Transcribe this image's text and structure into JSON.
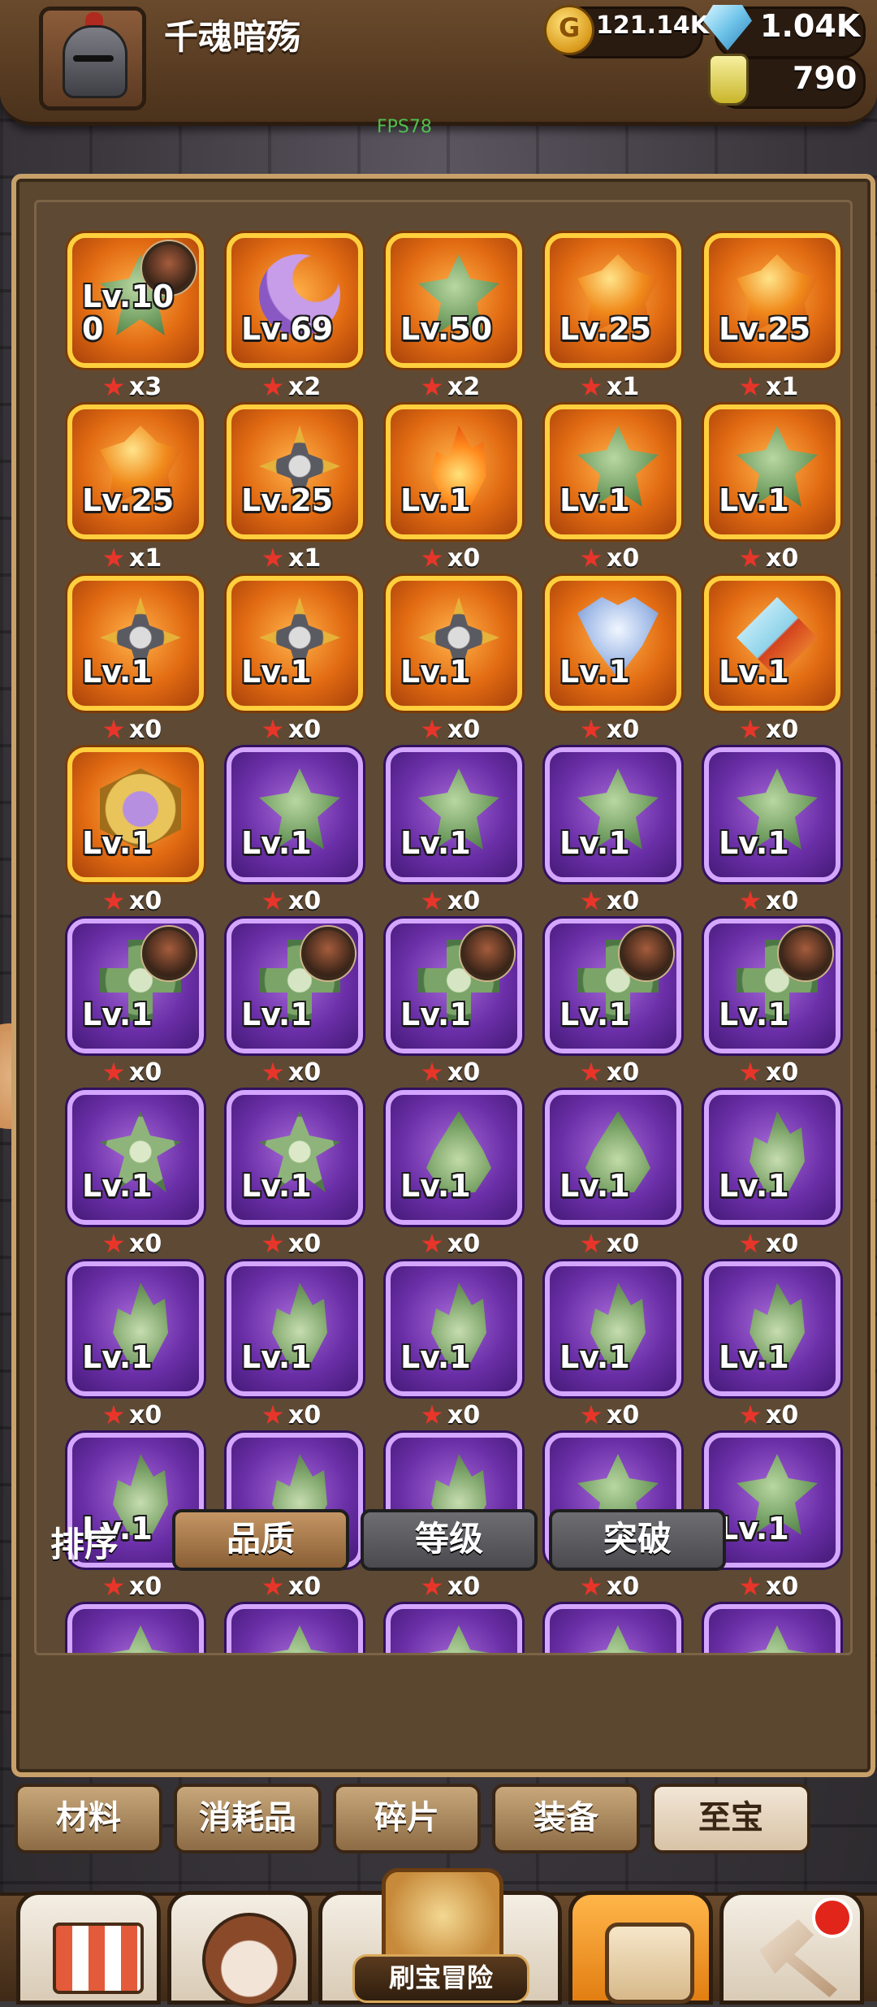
{
  "header": {
    "player_name": "千魂暗殇",
    "gold": "121.14K",
    "gems": "1.04K",
    "potions": "790",
    "fps": "FPS78"
  },
  "items": [
    {
      "lv": "Lv.10\n0",
      "count": "x3",
      "quality": "orange",
      "icon": "leaf-ornament-icon",
      "badge": true
    },
    {
      "lv": "Lv.69",
      "count": "x2",
      "quality": "orange",
      "icon": "crescent-moon-icon",
      "badge": false
    },
    {
      "lv": "Lv.50",
      "count": "x2",
      "quality": "orange",
      "icon": "green-crest-icon",
      "badge": false
    },
    {
      "lv": "Lv.25",
      "count": "x1",
      "quality": "orange",
      "icon": "flame-crest-icon",
      "badge": false
    },
    {
      "lv": "Lv.25",
      "count": "x1",
      "quality": "orange",
      "icon": "flame-crest-icon",
      "badge": false
    },
    {
      "lv": "Lv.25",
      "count": "x1",
      "quality": "orange",
      "icon": "flame-crest-icon",
      "badge": false
    },
    {
      "lv": "Lv.25",
      "count": "x1",
      "quality": "orange",
      "icon": "shuriken-icon",
      "badge": false
    },
    {
      "lv": "Lv.1",
      "count": "x0",
      "quality": "orange",
      "icon": "fire-icon",
      "badge": false
    },
    {
      "lv": "Lv.1",
      "count": "x0",
      "quality": "orange",
      "icon": "green-crest-icon",
      "badge": false
    },
    {
      "lv": "Lv.1",
      "count": "x0",
      "quality": "orange",
      "icon": "green-crest-icon",
      "badge": false
    },
    {
      "lv": "Lv.1",
      "count": "x0",
      "quality": "orange",
      "icon": "shuriken-icon",
      "badge": false
    },
    {
      "lv": "Lv.1",
      "count": "x0",
      "quality": "orange",
      "icon": "shuriken-icon",
      "badge": false
    },
    {
      "lv": "Lv.1",
      "count": "x0",
      "quality": "orange",
      "icon": "shuriken-icon",
      "badge": false
    },
    {
      "lv": "Lv.1",
      "count": "x0",
      "quality": "orange",
      "icon": "angel-wing-icon",
      "badge": false
    },
    {
      "lv": "Lv.1",
      "count": "x0",
      "quality": "orange",
      "icon": "crystal-star-icon",
      "badge": false
    },
    {
      "lv": "Lv.1",
      "count": "x0",
      "quality": "orange",
      "icon": "star-badge-icon",
      "badge": false
    },
    {
      "lv": "Lv.1",
      "count": "x0",
      "quality": "purple",
      "icon": "dragon-head-icon",
      "badge": false
    },
    {
      "lv": "Lv.1",
      "count": "x0",
      "quality": "purple",
      "icon": "dragon-head-icon",
      "badge": false
    },
    {
      "lv": "Lv.1",
      "count": "x0",
      "quality": "purple",
      "icon": "dragon-head-icon",
      "badge": false
    },
    {
      "lv": "Lv.1",
      "count": "x0",
      "quality": "purple",
      "icon": "dragon-head-icon",
      "badge": false
    },
    {
      "lv": "Lv.1",
      "count": "x0",
      "quality": "purple",
      "icon": "cross-shield-icon",
      "badge": true
    },
    {
      "lv": "Lv.1",
      "count": "x0",
      "quality": "purple",
      "icon": "cross-shield-icon",
      "badge": true
    },
    {
      "lv": "Lv.1",
      "count": "x0",
      "quality": "purple",
      "icon": "cross-shield-icon",
      "badge": true
    },
    {
      "lv": "Lv.1",
      "count": "x0",
      "quality": "purple",
      "icon": "cross-shield-icon",
      "badge": true
    },
    {
      "lv": "Lv.1",
      "count": "x0",
      "quality": "purple",
      "icon": "cross-shield-icon",
      "badge": true
    },
    {
      "lv": "Lv.1",
      "count": "x0",
      "quality": "purple",
      "icon": "clover-icon",
      "badge": false
    },
    {
      "lv": "Lv.1",
      "count": "x0",
      "quality": "purple",
      "icon": "clover-icon",
      "badge": false
    },
    {
      "lv": "Lv.1",
      "count": "x0",
      "quality": "purple",
      "icon": "water-drop-icon",
      "badge": false
    },
    {
      "lv": "Lv.1",
      "count": "x0",
      "quality": "purple",
      "icon": "water-drop-icon",
      "badge": false
    },
    {
      "lv": "Lv.1",
      "count": "x0",
      "quality": "purple",
      "icon": "green-flame-icon",
      "badge": false
    },
    {
      "lv": "Lv.1",
      "count": "x0",
      "quality": "purple",
      "icon": "green-flame-icon",
      "badge": false
    },
    {
      "lv": "Lv.1",
      "count": "x0",
      "quality": "purple",
      "icon": "green-flame-icon",
      "badge": false
    },
    {
      "lv": "Lv.1",
      "count": "x0",
      "quality": "purple",
      "icon": "green-flame-icon",
      "badge": false
    },
    {
      "lv": "Lv.1",
      "count": "x0",
      "quality": "purple",
      "icon": "green-flame-icon",
      "badge": false
    },
    {
      "lv": "Lv.1",
      "count": "x0",
      "quality": "purple",
      "icon": "green-flame-icon",
      "badge": false
    },
    {
      "lv": "Lv.1",
      "count": "x0",
      "quality": "purple",
      "icon": "green-flame-icon",
      "badge": false
    },
    {
      "lv": "Lv.1",
      "count": "x0",
      "quality": "purple",
      "icon": "green-flame-icon",
      "badge": false
    },
    {
      "lv": "Lv.1",
      "count": "x0",
      "quality": "purple",
      "icon": "green-flame-icon",
      "badge": false
    },
    {
      "lv": "Lv.1",
      "count": "x0",
      "quality": "purple",
      "icon": "green-crest-icon",
      "badge": false
    },
    {
      "lv": "Lv.1",
      "count": "x0",
      "quality": "purple",
      "icon": "green-crest-icon",
      "badge": false
    },
    {
      "lv": "",
      "count": "",
      "quality": "purple",
      "icon": "green-crest-icon",
      "badge": false
    },
    {
      "lv": "",
      "count": "",
      "quality": "purple",
      "icon": "green-crest-icon",
      "badge": false
    },
    {
      "lv": "",
      "count": "",
      "quality": "purple",
      "icon": "dragon-head-icon",
      "badge": false
    },
    {
      "lv": "",
      "count": "",
      "quality": "purple",
      "icon": "dragon-head-icon",
      "badge": false
    },
    {
      "lv": "",
      "count": "",
      "quality": "purple",
      "icon": "dragon-head-icon",
      "badge": false
    }
  ],
  "sort": {
    "label": "排序",
    "options": [
      "品质",
      "等级",
      "突破"
    ],
    "active": 0
  },
  "categories": {
    "tabs": [
      "材料",
      "消耗品",
      "碎片",
      "装备",
      "至宝"
    ],
    "active": 4
  },
  "bottom_nav": {
    "adventure_label": "刷宝冒险",
    "items": [
      "shop-icon",
      "hero-icon",
      "adventure-icon",
      "inventory-icon",
      "forge-icon"
    ],
    "active": 3
  },
  "colors": {
    "orange_quality": "#e26b12",
    "purple_quality": "#6b2fa8",
    "panel": "#5b4630"
  }
}
